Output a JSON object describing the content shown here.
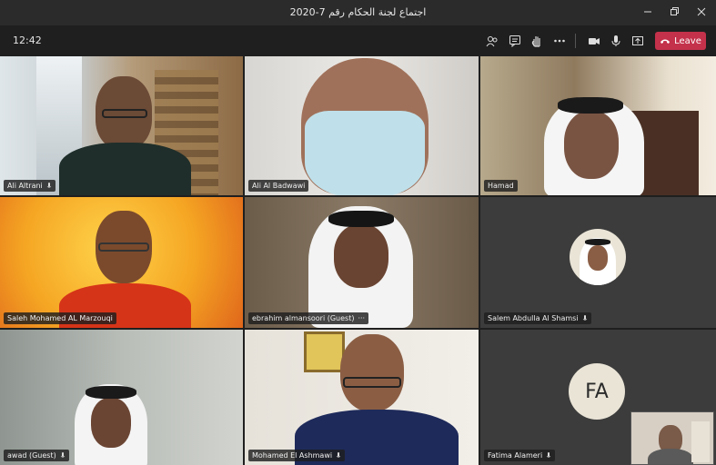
{
  "window": {
    "title": "اجتماع لجنة الحكام رقم 7-2020"
  },
  "meeting": {
    "clock": "12:42",
    "leave_label": "Leave"
  },
  "icons": {
    "people": "people-icon",
    "chat": "chat-icon",
    "raise_hand": "raise-hand-icon",
    "more": "more-icon",
    "camera": "camera-icon",
    "mic": "mic-icon",
    "share": "share-icon"
  },
  "colors": {
    "leave": "#c4314b",
    "avatar_bg": "#e9e4d6"
  },
  "participants": [
    {
      "name": "Ali Altrani",
      "mic": true
    },
    {
      "name": "Ali Al Badwawi",
      "mic": false
    },
    {
      "name": "Hamad",
      "mic": false
    },
    {
      "name": "Saleh Mohamed AL Marzouqi",
      "mic": false
    },
    {
      "name": "ebrahim almansoori (Guest)",
      "more": "···"
    },
    {
      "name": "Salem Abdulla Al Shamsi",
      "mic": true
    },
    {
      "name": "awad (Guest)",
      "mic": true
    },
    {
      "name": "Mohamed El Ashmawi",
      "mic": true
    },
    {
      "name": "Fatima Alameri",
      "mic": true,
      "initials": "FA"
    }
  ]
}
